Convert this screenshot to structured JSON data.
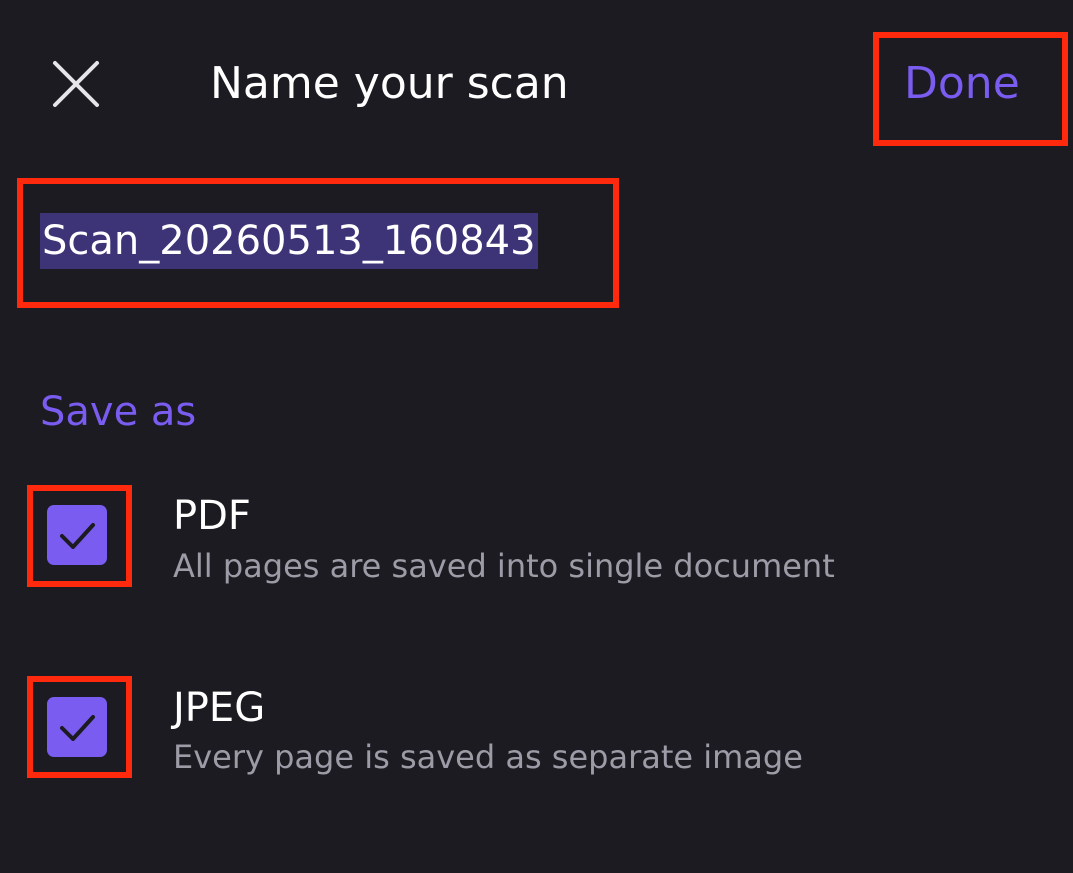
{
  "header": {
    "title": "Name your scan",
    "done_label": "Done",
    "close_icon": "close-icon"
  },
  "filename": {
    "value": "Scan_20260513_160843",
    "selected": true
  },
  "save_as": {
    "label": "Save as",
    "options": [
      {
        "title": "PDF",
        "description": "All pages are saved into single document",
        "checked": true
      },
      {
        "title": "JPEG",
        "description": "Every page is saved as separate image",
        "checked": true
      }
    ]
  },
  "colors": {
    "background": "#1c1b22",
    "accent": "#7a5cf0",
    "selection": "#3d3478",
    "secondary_text": "#9c9ba6",
    "annotation_box": "#ff2a0e"
  }
}
